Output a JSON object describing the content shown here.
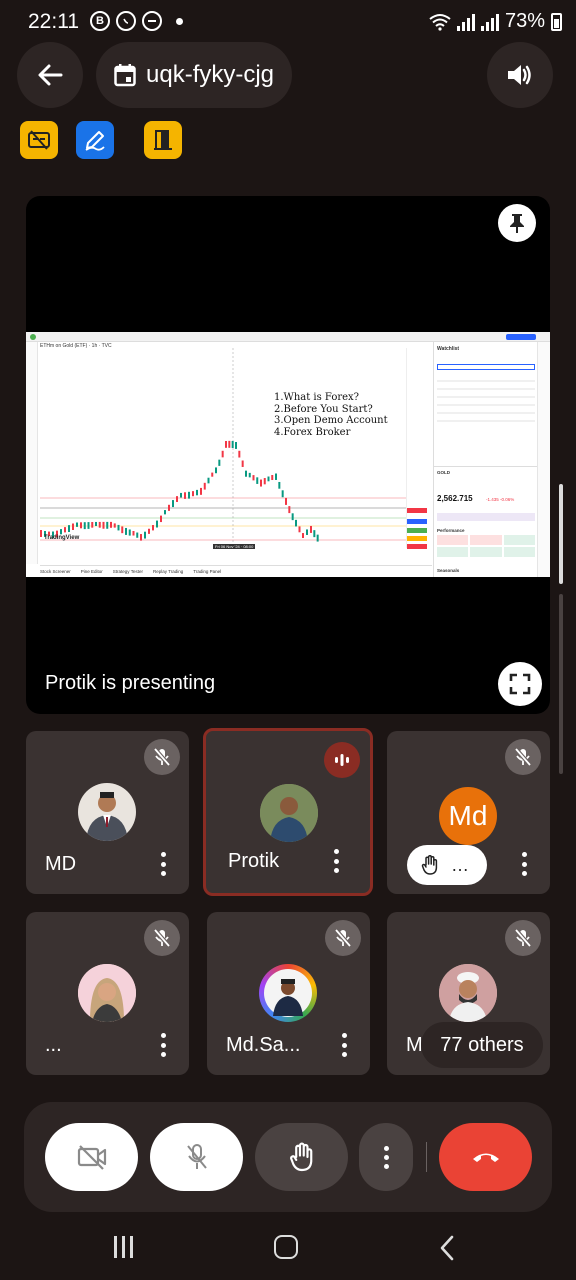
{
  "status_bar": {
    "time": "22:11",
    "icon_b": "B",
    "battery": "73%"
  },
  "header": {
    "meeting_code": "uqk-fyky-cjg"
  },
  "toolbar_icons": [
    "caption-off-icon",
    "whiteboard-edit-icon",
    "door-exit-icon"
  ],
  "presentation": {
    "status_text": "Protik is presenting",
    "slide": {
      "top_left_title": "ETHm on Gold (ETF) · 1h · TVC",
      "agenda": [
        "1.What is Forex?",
        "2.Before You Start?",
        "3.Open Demo Account",
        "4.Forex Broker"
      ],
      "watchlist_header": "Watchlist",
      "price": "2,562.715",
      "change": "-1.435  -0.06%",
      "chart_watermark": "TradingView",
      "chart_time_label": "Fri 06 Nov '24 · 08:00",
      "bottom_tabs": [
        "Stock Screener",
        "Pine Editor",
        "Strategy Tester",
        "Replay Trading",
        "Trading Panel"
      ],
      "side_labels": [
        "GOLD",
        "Performance",
        "Seasonals"
      ]
    }
  },
  "participants": [
    {
      "name": "MD",
      "avatar": "photo",
      "mic_muted": true
    },
    {
      "name": "Protik",
      "avatar": "photo",
      "mic_muted": false,
      "speaking": true
    },
    {
      "name": "",
      "avatar_initials": "Md",
      "mic_muted": true,
      "hand_raised_label": "…"
    },
    {
      "name": "...",
      "avatar": "photo",
      "mic_muted": true
    },
    {
      "name": "Md.Sa...",
      "avatar": "photo",
      "mic_muted": true
    },
    {
      "name": "Md",
      "avatar": "photo",
      "mic_muted": true,
      "others_label": "77 others"
    }
  ],
  "colors": {
    "background": "#1c1514",
    "tile": "#3a3231",
    "surface": "#2d2524",
    "active_border": "#8a2c23",
    "end_call": "#ea4335",
    "avatar_orange": "#e8710a",
    "tool_yellow": "#f5b400",
    "tool_blue": "#1a73e8"
  }
}
